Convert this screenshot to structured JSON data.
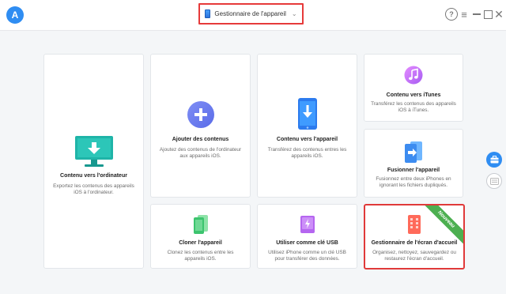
{
  "titlebar": {
    "app_logo": "A",
    "device_selector_label": "Gestionnaire de l'appareil",
    "help": "?",
    "menu": "≡",
    "close": "✕"
  },
  "cards": {
    "computer": {
      "title": "Contenu vers l'ordinateur",
      "desc": "Exportez les contenus des appareils iOS à l'ordinateur."
    },
    "add": {
      "title": "Ajouter des contenus",
      "desc": "Ajoutez des contenus de l'ordinateur aux appareils iOS."
    },
    "device": {
      "title": "Contenu vers l'appareil",
      "desc": "Transférez des contenus entres les appareils iOS."
    },
    "itunes": {
      "title": "Contenu vers iTunes",
      "desc": "Transférez les contenus des appareils iOS à iTunes."
    },
    "merge": {
      "title": "Fusionner l'appareil",
      "desc": "Fusionnez entre deux iPhones en ignorant les fichiers dupliqués."
    },
    "clone": {
      "title": "Cloner l'appareil",
      "desc": "Clonez les contenus entre les appareils iOS."
    },
    "usb": {
      "title": "Utiliser comme clé USB",
      "desc": "Utilisez iPhone comme un clé USB pour transférer des données."
    },
    "home": {
      "title": "Gestionnaire de l'écran d'accueil",
      "desc": "Organisez, nettoyez, sauvegardez ou restaurez l'écran d'accueil.",
      "ribbon": "Nouveau"
    }
  },
  "colors": {
    "accent": "#2f8df2",
    "highlight_border": "#e03a3a",
    "ribbon": "#4caf50"
  }
}
